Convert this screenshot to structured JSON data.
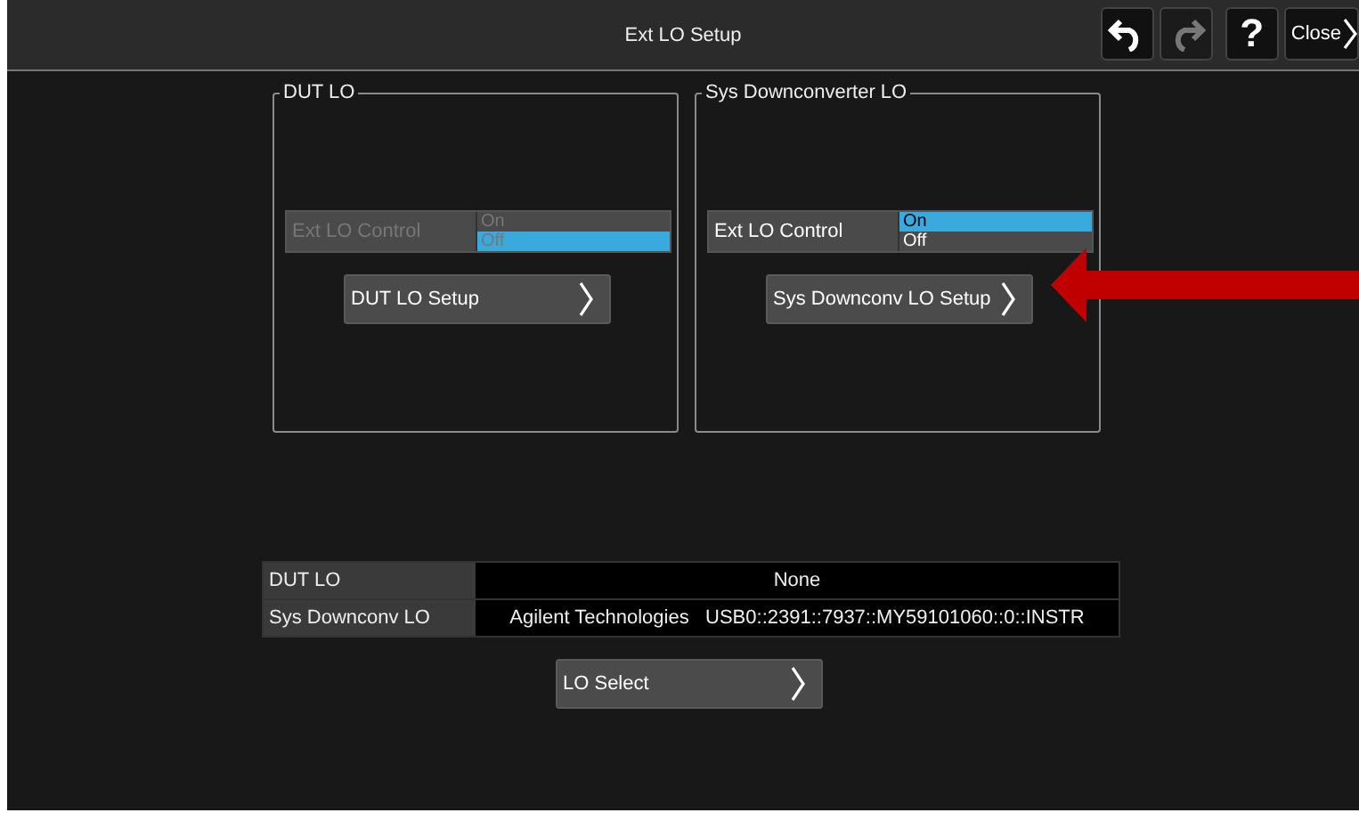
{
  "window": {
    "title": "Ext LO Setup"
  },
  "toolbar": [
    {
      "kind": "undo",
      "disabled": false
    },
    {
      "kind": "redo",
      "disabled": true
    },
    {
      "kind": "help",
      "label": "?",
      "disabled": false
    },
    {
      "kind": "close",
      "label": "Close",
      "disabled": false
    }
  ],
  "groups": [
    {
      "title": "DUT LO",
      "control": {
        "label": "Ext LO Control",
        "disabled": true,
        "options": [
          {
            "label": "On",
            "selected": false
          },
          {
            "label": "Off",
            "selected": true
          }
        ]
      },
      "setup_button": "DUT LO Setup"
    },
    {
      "title": "Sys Downconverter LO",
      "control": {
        "label": "Ext LO Control",
        "disabled": false,
        "options": [
          {
            "label": "On",
            "selected": true
          },
          {
            "label": "Off",
            "selected": false
          }
        ]
      },
      "setup_button": "Sys Downconv LO Setup"
    }
  ],
  "lo_table": [
    {
      "name": "DUT LO",
      "value": "None"
    },
    {
      "name": "Sys Downconv LO",
      "value": "Agilent Technologies   USB0::2391::7937::MY59101060::0::INSTR"
    }
  ],
  "lo_select_button": "LO Select"
}
